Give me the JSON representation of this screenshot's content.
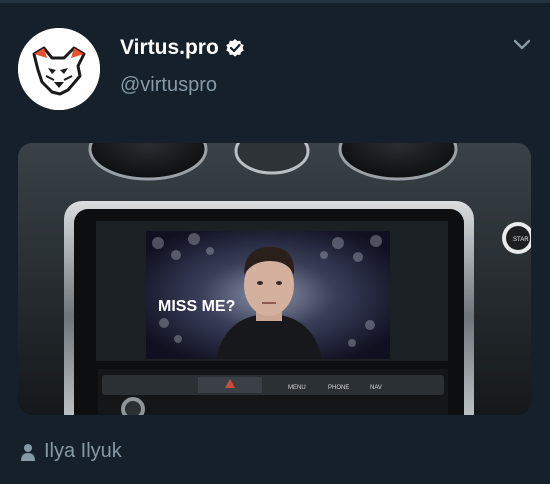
{
  "account": {
    "name": "Virtus.pro",
    "handle": "@virtuspro",
    "verified": true
  },
  "media": {
    "overlay_text": "MISS ME?",
    "console_buttons": [
      "MENU",
      "PHONE",
      "NAV"
    ],
    "start_label": "STAR"
  },
  "attribution": {
    "author": "Ilya Ilyuk"
  },
  "colors": {
    "background": "#15202b",
    "secondary_text": "#8899a6",
    "logo_orange": "#e8502e"
  },
  "icons": [
    "virtuspro-bear-logo",
    "verified-badge-icon",
    "chevron-down-icon",
    "person-icon"
  ]
}
